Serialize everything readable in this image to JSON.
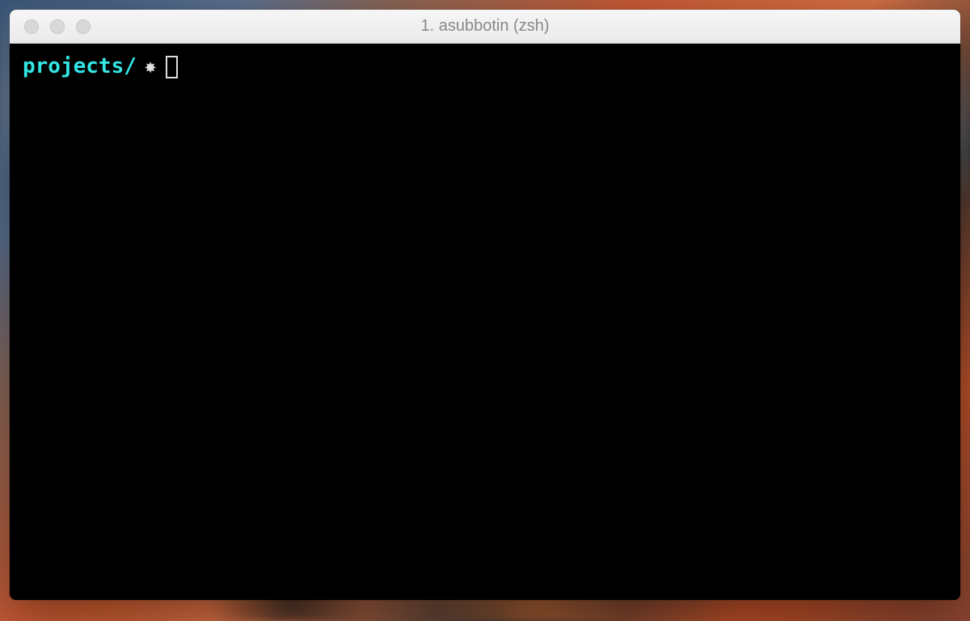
{
  "window": {
    "title": "1. asubbotin (zsh)"
  },
  "terminal": {
    "prompt_cwd": "projects/",
    "prompt_symbol_icon": "sun-icon"
  }
}
